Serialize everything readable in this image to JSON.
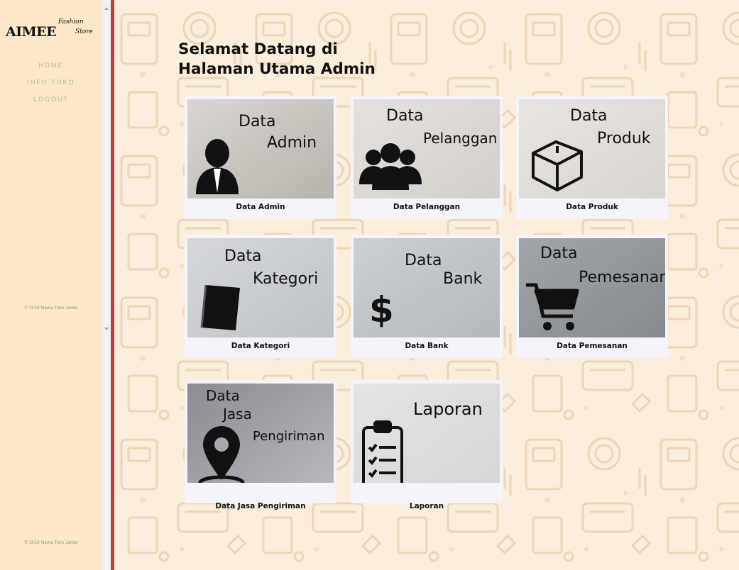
{
  "brand": {
    "name": "AIMEE",
    "tag_1": "Fashion",
    "tag_2": "Store"
  },
  "nav": [
    {
      "label": "HOME"
    },
    {
      "label": "INFO TOKO"
    },
    {
      "label": "LOGOUT"
    }
  ],
  "footer": {
    "copyright": "© 2019 Nama Toko Jambi"
  },
  "main": {
    "greeting_line1": "Selamat Datang di",
    "greeting_line2": "Halaman Utama Admin"
  },
  "cards": [
    {
      "caption": "Data Admin",
      "words": [
        "Data",
        "Admin"
      ],
      "icon": "user-icon"
    },
    {
      "caption": "Data Pelanggan",
      "words": [
        "Data",
        "Pelanggan"
      ],
      "icon": "users-icon"
    },
    {
      "caption": "Data Produk",
      "words": [
        "Data",
        "Produk"
      ],
      "icon": "box-icon"
    },
    {
      "caption": "Data Kategori",
      "words": [
        "Data",
        "Kategori"
      ],
      "icon": "book-icon"
    },
    {
      "caption": "Data Bank",
      "words": [
        "Data",
        "Bank"
      ],
      "icon": "dollar-icon"
    },
    {
      "caption": "Data Pemesanan",
      "words": [
        "Data",
        "Pemesanan"
      ],
      "icon": "cart-icon"
    },
    {
      "caption": "Data Jasa Pengiriman",
      "words": [
        "Data",
        "Jasa",
        "Pengiriman"
      ],
      "icon": "map-pin-icon"
    },
    {
      "caption": "Laporan",
      "words": [
        "Laporan"
      ],
      "icon": "clipboard-icon"
    }
  ],
  "colors": {
    "sidebar": "#fde9c9",
    "accent": "#bd3c3c",
    "background": "#fbeedd",
    "card": "#f6f4fb"
  }
}
